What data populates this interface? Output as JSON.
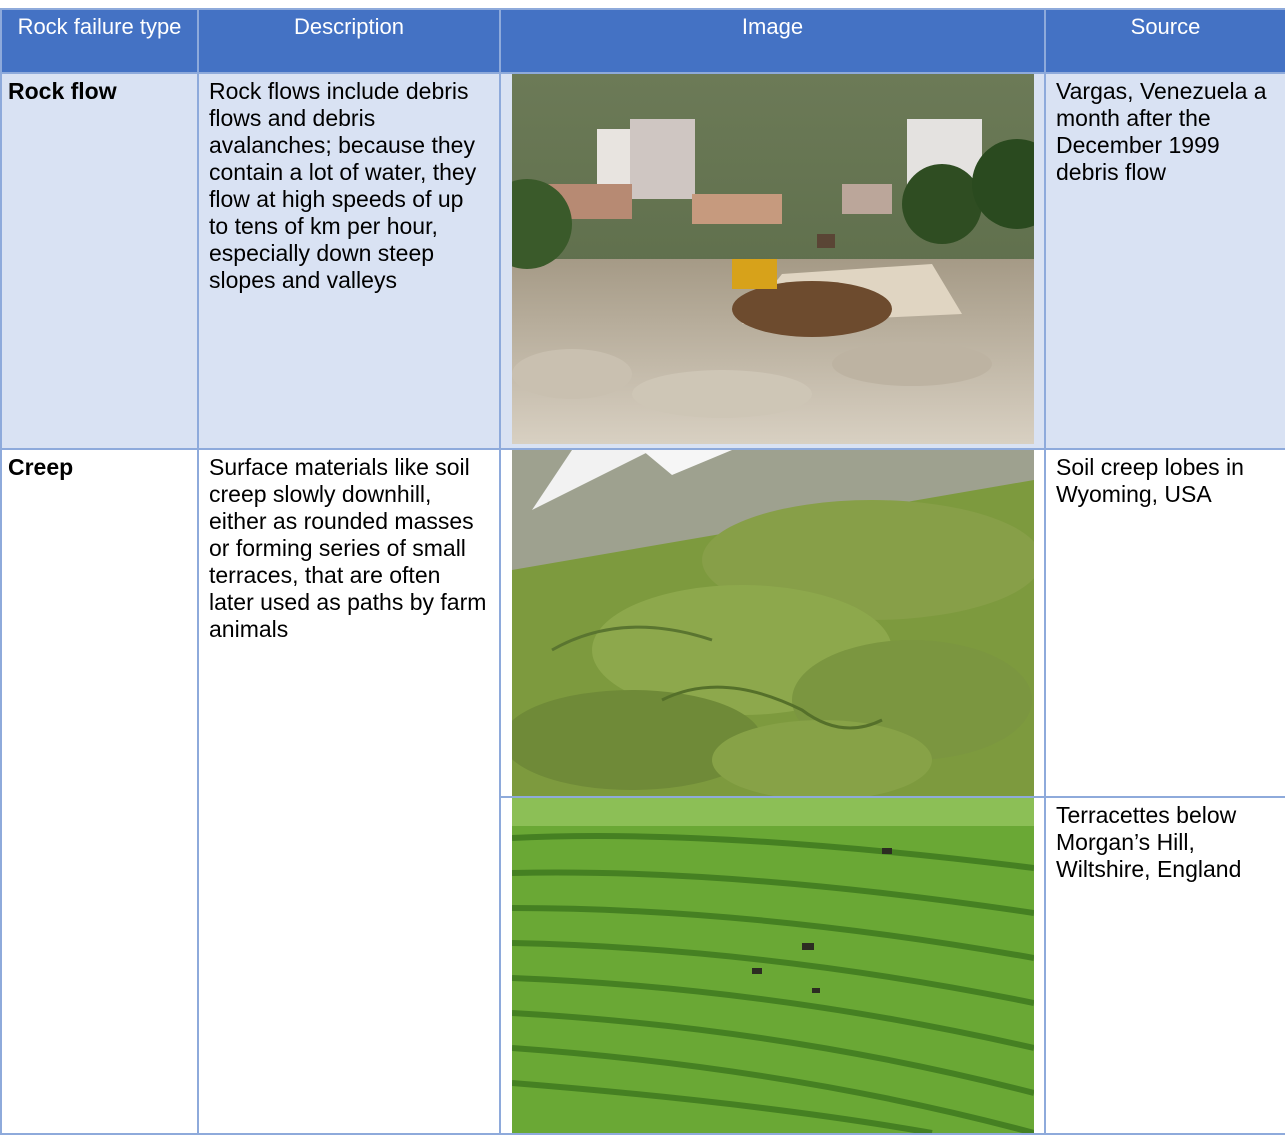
{
  "table": {
    "headers": [
      "Rock failure type",
      "Description",
      "Image",
      "Source"
    ],
    "rows": [
      {
        "type": "Rock flow",
        "description": "Rock flows include debris flows and debris avalanches; because they contain a lot of water, they flow at high speeds of up to tens of km per hour, especially down steep slopes and valleys",
        "source": "Vargas, Venezuela a month after the December 1999 debris flow"
      },
      {
        "type": "Creep",
        "description": "Surface materials like soil creep slowly downhill, either as rounded masses or forming series of small terraces, that are often later used as paths by farm animals",
        "source": "Soil creep lobes in Wyoming, USA"
      },
      {
        "source": "Terracettes below Morgan’s Hill, Wiltshire, England"
      }
    ]
  },
  "images": [
    {
      "icon": "debris-flow-photo"
    },
    {
      "icon": "soil-creep-lobes-photo"
    },
    {
      "icon": "terracettes-photo"
    }
  ],
  "colors": {
    "header_bg": "#4472c4",
    "band_bg": "#d9e2f3",
    "border": "#8eaadb",
    "header_text": "#ffffff"
  }
}
